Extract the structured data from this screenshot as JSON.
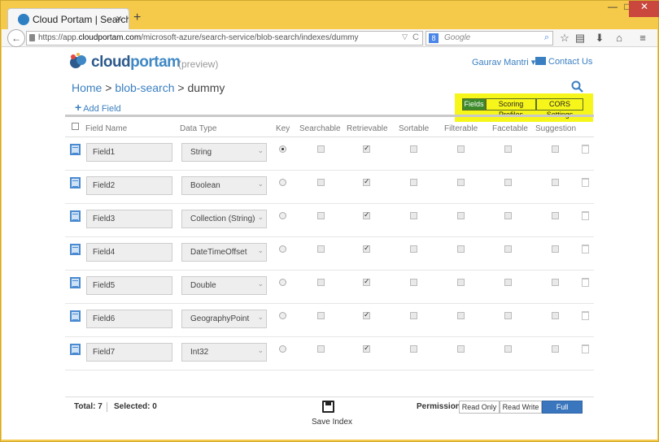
{
  "browser": {
    "tab_title": "Cloud Portam | Search Serv…",
    "tab_close": "×",
    "new_tab": "+",
    "win_min": "—",
    "win_max": "□",
    "win_close": "✕",
    "back": "←",
    "url_prefix": "https://app.",
    "url_host": "cloudportam.com",
    "url_path": "/microsoft-azure/search-service/blob-search/indexes/dummy",
    "url_dropdown": "▽",
    "url_reload": "C",
    "search_engine": "8",
    "search_placeholder": "Google",
    "search_mag": "⌕",
    "tb_star": "☆",
    "tb_clip": "▤",
    "tb_down": "⬇",
    "tb_home": "⌂",
    "tb_menu": "≡"
  },
  "header": {
    "logo_cloud": "cloud",
    "logo_portam": "portam",
    "preview": "(preview)",
    "user": "Gaurav Mantri ▾",
    "contact": "Contact Us"
  },
  "breadcrumb": {
    "home": "Home",
    "sep1": " > ",
    "service": "blob-search",
    "sep2": " > ",
    "index": "dummy"
  },
  "add_field": {
    "plus": "+",
    "label": "Add Field"
  },
  "tabs": [
    {
      "label": "Fields",
      "active": true
    },
    {
      "label": "Scoring Profiles",
      "active": false
    },
    {
      "label": "CORS Settings",
      "active": false
    }
  ],
  "columns": {
    "name": "Field Name",
    "type": "Data Type",
    "key": "Key",
    "searchable": "Searchable",
    "retrievable": "Retrievable",
    "sortable": "Sortable",
    "filterable": "Filterable",
    "facetable": "Facetable",
    "suggestion": "Suggestion"
  },
  "rows": [
    {
      "name": "Field1",
      "type": "String",
      "key": true,
      "searchable": false,
      "retrievable": true,
      "sortable": false,
      "filterable": false,
      "facetable": false,
      "suggestion": false
    },
    {
      "name": "Field2",
      "type": "Boolean",
      "key": false,
      "searchable": false,
      "retrievable": true,
      "sortable": false,
      "filterable": false,
      "facetable": false,
      "suggestion": false
    },
    {
      "name": "Field3",
      "type": "Collection (String)",
      "key": false,
      "searchable": false,
      "retrievable": true,
      "sortable": false,
      "filterable": false,
      "facetable": false,
      "suggestion": false
    },
    {
      "name": "Field4",
      "type": "DateTimeOffset",
      "key": false,
      "searchable": false,
      "retrievable": true,
      "sortable": false,
      "filterable": false,
      "facetable": false,
      "suggestion": false
    },
    {
      "name": "Field5",
      "type": "Double",
      "key": false,
      "searchable": false,
      "retrievable": true,
      "sortable": false,
      "filterable": false,
      "facetable": false,
      "suggestion": false
    },
    {
      "name": "Field6",
      "type": "GeographyPoint",
      "key": false,
      "searchable": false,
      "retrievable": true,
      "sortable": false,
      "filterable": false,
      "facetable": false,
      "suggestion": false
    },
    {
      "name": "Field7",
      "type": "Int32",
      "key": false,
      "searchable": false,
      "retrievable": true,
      "sortable": false,
      "filterable": false,
      "facetable": false,
      "suggestion": false
    }
  ],
  "select_caret": "⌄",
  "footer": {
    "total": "Total: 7",
    "selected": "Selected: 0",
    "save": "Save Index",
    "permission_label": "Permission:",
    "permissions": [
      {
        "label": "Read Only",
        "active": false
      },
      {
        "label": "Read Write",
        "active": false
      },
      {
        "label": "Full",
        "active": true
      }
    ]
  },
  "colors": {
    "accent": "#3a7fc1",
    "highlight": "#f7f61b",
    "active_tab": "#3b8a2a",
    "permission_active": "#3a76bd"
  },
  "icons": {
    "favicon": "cloud-portam-favicon",
    "row": "field-settings-icon",
    "delete": "trash-icon",
    "save": "floppy-disk-icon",
    "search": "search-icon",
    "contact": "envelope-icon"
  }
}
